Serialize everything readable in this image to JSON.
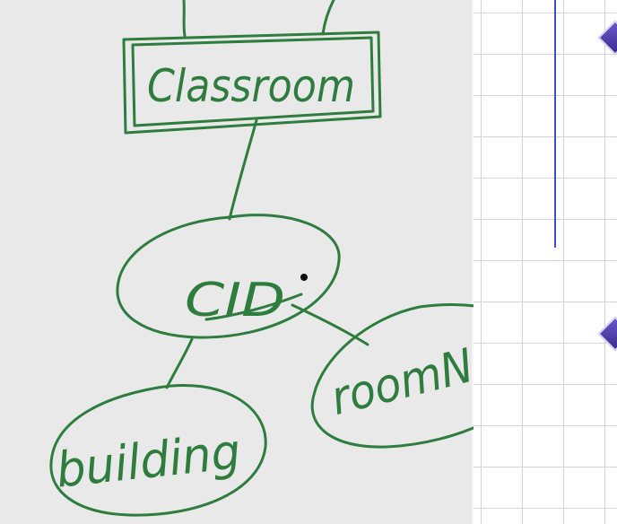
{
  "diagram": {
    "entity": {
      "label": "Classroom"
    },
    "key_attribute": {
      "label": "CID"
    },
    "attributes": [
      {
        "label": "building"
      },
      {
        "label": "roomNo"
      }
    ]
  },
  "colors": {
    "ink": "#2e7d3e",
    "canvas": "#e9e9e9",
    "grid_line": "#d4d4d4",
    "rule": "#3c4fc8",
    "marker": "#4a3aa8"
  },
  "icons": [
    "diamond-marker-icon",
    "diamond-marker-icon"
  ]
}
